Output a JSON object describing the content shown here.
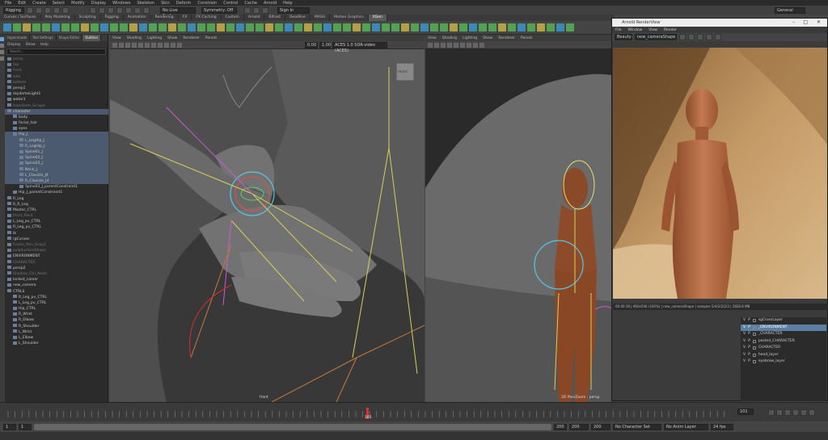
{
  "menubar": {
    "items": [
      "File",
      "Edit",
      "Create",
      "Select",
      "Modify",
      "Display",
      "Windows",
      "Skeleton",
      "Skin",
      "Deform",
      "Constrain",
      "Control",
      "Cache",
      "Arnold",
      "Help"
    ],
    "workspace": "General"
  },
  "statusline": {
    "mode": "Rigging",
    "live_surface": "No Live Surface",
    "symmetry": "Symmetry: Off",
    "sign_in": "Sign In"
  },
  "shelf": {
    "tabs": [
      "Curves / Surfaces",
      "Poly Modeling",
      "Sculpting",
      "Rigging",
      "Animation",
      "Rendering",
      "FX",
      "FX Caching",
      "Custom",
      "Arnold",
      "Bifrost",
      "Deadline",
      "MASH",
      "Motion Graphics",
      "XGen"
    ],
    "active_tab": "XGen"
  },
  "outliner": {
    "tabs": [
      "Hypershade",
      "Tool Settings",
      "Shape Editor",
      "Outliner"
    ],
    "active_tab": "Outliner",
    "menu": [
      "Display",
      "Show",
      "Help"
    ],
    "search_placeholder": "Search...",
    "items": [
      {
        "label": "persp",
        "cls": "dim"
      },
      {
        "label": "top",
        "cls": "dim"
      },
      {
        "label": "front",
        "cls": "dim"
      },
      {
        "label": "side",
        "cls": "dim"
      },
      {
        "label": "bottom",
        "cls": "dim"
      },
      {
        "label": "persp1",
        "cls": ""
      },
      {
        "label": "skydomeLight1",
        "cls": ""
      },
      {
        "label": "water1",
        "cls": ""
      },
      {
        "label": "transform_Scrape",
        "cls": "dim"
      },
      {
        "label": "character",
        "cls": "sel"
      },
      {
        "label": "body",
        "cls": ""
      },
      {
        "label": "facial_hair",
        "cls": ""
      },
      {
        "label": "eyes",
        "cls": ""
      },
      {
        "label": "Hip_J",
        "cls": "sel"
      },
      {
        "label": "L_LegHip_J",
        "cls": "sel"
      },
      {
        "label": "R_LegHip_J",
        "cls": "sel"
      },
      {
        "label": "Spine01_J",
        "cls": "sel"
      },
      {
        "label": "Spine02_J",
        "cls": "sel"
      },
      {
        "label": "Spine03_J",
        "cls": "sel"
      },
      {
        "label": "Neck_J",
        "cls": "sel"
      },
      {
        "label": "L_Clavicle_J4",
        "cls": "sel"
      },
      {
        "label": "R_Clavicle_J4",
        "cls": "sel"
      },
      {
        "label": "Spine03_J_parentConstraint1",
        "cls": ""
      },
      {
        "label": "Hip_J_parentConstraint1",
        "cls": ""
      },
      {
        "label": "R_Leg",
        "cls": ""
      },
      {
        "label": "R_R_Leg",
        "cls": ""
      },
      {
        "label": "Master_CTRL",
        "cls": ""
      },
      {
        "label": "Prsnt_Ren1",
        "cls": "dim"
      },
      {
        "label": "L_Leg_pv_CTRL",
        "cls": ""
      },
      {
        "label": "R_Leg_pv_CTRL",
        "cls": ""
      },
      {
        "label": "Ik",
        "cls": ""
      },
      {
        "label": "rgCurves",
        "cls": ""
      },
      {
        "label": "Frame_Ren_Gray3",
        "cls": "dim"
      },
      {
        "label": "polySurfaceShape",
        "cls": "dim"
      },
      {
        "label": "ENVIRONMENT",
        "cls": ""
      },
      {
        "label": "CHARACTER",
        "cls": "dim"
      },
      {
        "label": "persp2",
        "cls": ""
      },
      {
        "label": "Shadow_Ctrl_Node",
        "cls": "dim"
      },
      {
        "label": "locked_camer",
        "cls": ""
      },
      {
        "label": "new_camera",
        "cls": ""
      },
      {
        "label": "CTRLS",
        "cls": ""
      },
      {
        "label": "R_Leg_pv_CTRL",
        "cls": ""
      },
      {
        "label": "L_Leg_pv_CTRL",
        "cls": ""
      },
      {
        "label": "Hip_CTRL",
        "cls": ""
      },
      {
        "label": "R_Wrist",
        "cls": ""
      },
      {
        "label": "R_Elbow",
        "cls": ""
      },
      {
        "label": "R_Shoulder",
        "cls": ""
      },
      {
        "label": "L_Wrist",
        "cls": ""
      },
      {
        "label": "L_Elbow",
        "cls": ""
      },
      {
        "label": "L_Shoulder",
        "cls": ""
      }
    ]
  },
  "viewport_left": {
    "menu": [
      "View",
      "Shading",
      "Lighting",
      "Show",
      "Renderer",
      "Panels"
    ],
    "exposure": "0.00",
    "gamma": "1.00",
    "colorspace": "ACES 1.0 SDR-video (ACES)",
    "view_cube": "FRONT",
    "camera": "front"
  },
  "viewport_right": {
    "menu": [
      "View",
      "Shading",
      "Lighting",
      "Show",
      "Renderer",
      "Panels"
    ],
    "camera": "2D Pan/Zoom : persp"
  },
  "renderview": {
    "title": "Arnold RenderView",
    "menu": [
      "File",
      "Window",
      "View",
      "Render"
    ],
    "pass": "Beauty",
    "camera": "new_cameraShape",
    "status": "00:00:18 | 960x540 (100%) | new_cameraShape | samples 5/4/2/2/2/3 | 2828.8 MB",
    "layers": [
      {
        "label": "sgCrossLayer",
        "sel": false
      },
      {
        "label": "_ENVIRONMENT",
        "sel": true
      },
      {
        "label": "_CHARACTER",
        "sel": false
      },
      {
        "label": "pasted_CHARACTER",
        "sel": false
      },
      {
        "label": "CHARACTER",
        "sel": false
      },
      {
        "label": "head_layer",
        "sel": false
      },
      {
        "label": "eyebrow_layer",
        "sel": false
      }
    ]
  },
  "timeline": {
    "current_frame": "101",
    "frame_field": "101",
    "start": "1",
    "range_start": "1",
    "range_end": "200",
    "end_a": "200",
    "end_b": "200",
    "character_set": "No Character Set",
    "anim_layer": "No Anim Layer",
    "fps": "24 fps"
  }
}
